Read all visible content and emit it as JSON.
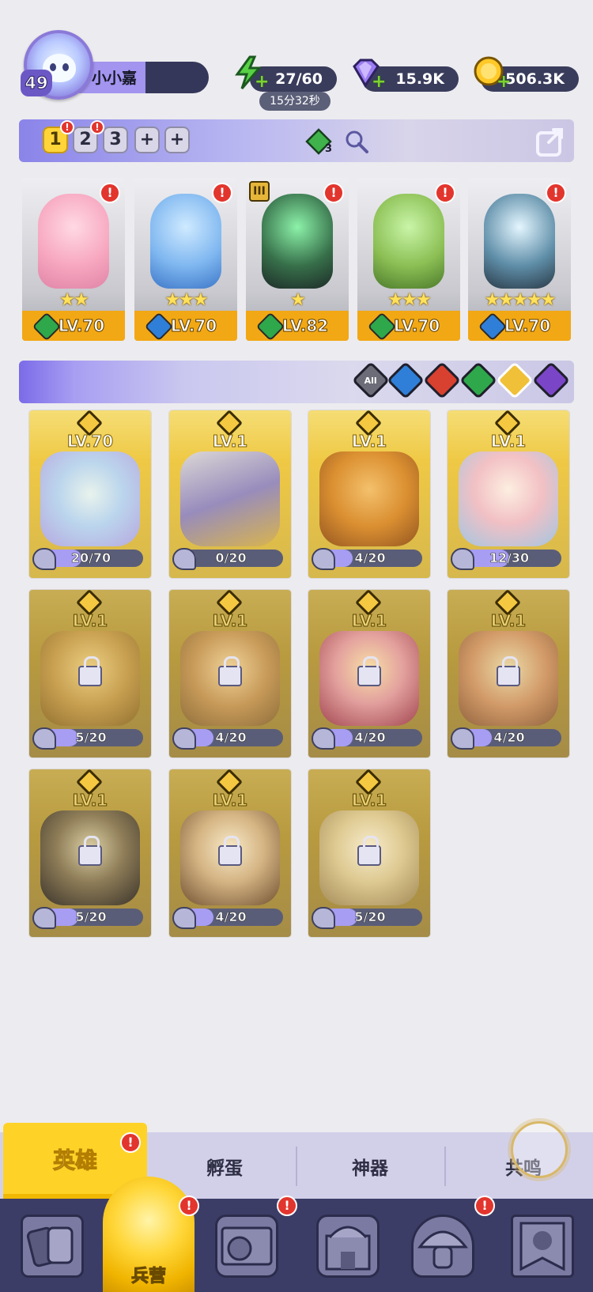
{
  "player": {
    "level": "49",
    "name": "小小嘉"
  },
  "resources": {
    "energy": "27/60",
    "energy_timer": "15分32秒",
    "gems": "15.9K",
    "gold": "506.3K"
  },
  "team_tabs": [
    {
      "label": "1",
      "active": true,
      "alert": "!"
    },
    {
      "label": "2",
      "active": false,
      "alert": "!"
    },
    {
      "label": "3",
      "active": false,
      "alert": ""
    },
    {
      "label": "+",
      "active": false,
      "alert": ""
    },
    {
      "label": "+",
      "active": false,
      "alert": ""
    }
  ],
  "team_gem_count": "3",
  "team_heroes": [
    {
      "level": "LV.70",
      "stars": "★★",
      "element": "nature",
      "alert": "!"
    },
    {
      "level": "LV.70",
      "stars": "★★★",
      "element": "water",
      "alert": "!"
    },
    {
      "level": "LV.82",
      "stars": "★",
      "element": "nature",
      "alert": "!",
      "rank": "III"
    },
    {
      "level": "LV.70",
      "stars": "★★★",
      "element": "nature",
      "alert": "!"
    },
    {
      "level": "LV.70",
      "stars": "★★★★★",
      "element": "water",
      "alert": "!"
    }
  ],
  "element_filters": [
    {
      "label": "All",
      "color": "#6c6c78"
    },
    {
      "label": "",
      "color": "#2f7fd8"
    },
    {
      "label": "",
      "color": "#d8402f"
    },
    {
      "label": "",
      "color": "#2ea84a"
    },
    {
      "label": "",
      "color": "#f0c038"
    },
    {
      "label": "",
      "color": "#7b45c8"
    }
  ],
  "heroes": [
    {
      "level": "LV.70",
      "progress": "20/70",
      "fraction": 0.29,
      "locked": false
    },
    {
      "level": "LV.1",
      "progress": "0/20",
      "fraction": 0.0,
      "locked": false
    },
    {
      "level": "LV.1",
      "progress": "4/20",
      "fraction": 0.2,
      "locked": false
    },
    {
      "level": "LV.1",
      "progress": "12/30",
      "fraction": 0.4,
      "locked": false
    },
    {
      "level": "LV.1",
      "progress": "5/20",
      "fraction": 0.25,
      "locked": true
    },
    {
      "level": "LV.1",
      "progress": "4/20",
      "fraction": 0.2,
      "locked": true
    },
    {
      "level": "LV.1",
      "progress": "4/20",
      "fraction": 0.2,
      "locked": true
    },
    {
      "level": "LV.1",
      "progress": "4/20",
      "fraction": 0.2,
      "locked": true
    },
    {
      "level": "LV.1",
      "progress": "5/20",
      "fraction": 0.25,
      "locked": true
    },
    {
      "level": "LV.1",
      "progress": "4/20",
      "fraction": 0.2,
      "locked": true
    },
    {
      "level": "LV.1",
      "progress": "5/20",
      "fraction": 0.25,
      "locked": true
    }
  ],
  "sub_tabs": {
    "hero": "英雄",
    "hatch": "孵蛋",
    "artifact": "神器",
    "resonance": "共鸣"
  },
  "bottom_nav": {
    "barracks": "兵营",
    "alert": "!"
  },
  "colors": {
    "accent": "#ffd228",
    "nav_bg": "#3c3d66",
    "page_bg": "#ecebef"
  }
}
